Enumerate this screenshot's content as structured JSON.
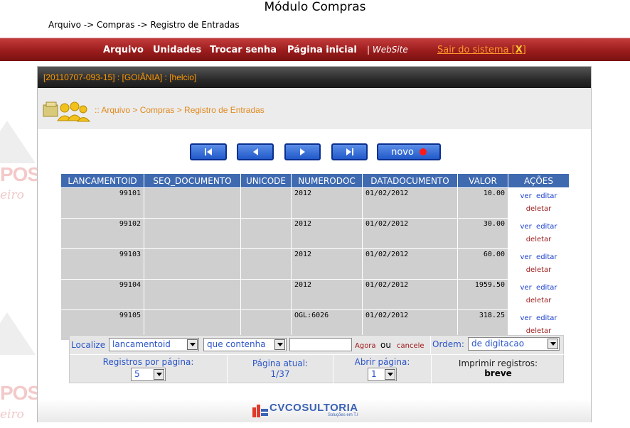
{
  "page": {
    "title": "Módulo Compras",
    "breadcrumb": "Arquivo -> Compras -> Registro de Entradas"
  },
  "navbar": {
    "items": [
      "Arquivo",
      "Unidades",
      "Trocar senha",
      "Página inicial"
    ],
    "website": "| WebSite",
    "logout_label": "Sair do sistema [",
    "logout_x": "X",
    "logout_close": "]"
  },
  "panel": {
    "header": "[20110707-093-15] : [GOIÂNIA] : [helcio]",
    "crumb": ":: Arquivo > Compras > Registro de Entradas"
  },
  "pager": {
    "novo_label": "novo"
  },
  "table": {
    "columns": [
      "LANCAMENTOID",
      "SEQ_DOCUMENTO",
      "UNICODE",
      "NUMERODOC",
      "DATADOCUMENTO",
      "VALOR",
      "AÇÕES"
    ],
    "rows": [
      {
        "lancamentoid": "99101",
        "seq_documento": "",
        "unicode": "",
        "numerodoc": "2012",
        "datadocumento": "01/02/2012",
        "valor": "10.00"
      },
      {
        "lancamentoid": "99102",
        "seq_documento": "",
        "unicode": "",
        "numerodoc": "2012",
        "datadocumento": "01/02/2012",
        "valor": "30.00"
      },
      {
        "lancamentoid": "99103",
        "seq_documento": "",
        "unicode": "",
        "numerodoc": "2012",
        "datadocumento": "01/02/2012",
        "valor": "60.00"
      },
      {
        "lancamentoid": "99104",
        "seq_documento": "",
        "unicode": "",
        "numerodoc": "2012",
        "datadocumento": "01/02/2012",
        "valor": "1959.50"
      },
      {
        "lancamentoid": "99105",
        "seq_documento": "",
        "unicode": "",
        "numerodoc": "OGL:6026",
        "datadocumento": "01/02/2012",
        "valor": "318.25"
      }
    ],
    "actions": {
      "ver": "ver",
      "editar": "editar",
      "deletar": "deletar"
    }
  },
  "search": {
    "localize_label": "Localize",
    "field_value": "lancamentoid",
    "condition_value": "que contenha",
    "text_value": "",
    "agora": "Agora",
    "ou": "ou",
    "cancele": "cancele",
    "ordem_label": "Ordem:",
    "ordem_value": "de digitacao",
    "registros_label": "Registros por página:",
    "registros_value": "5",
    "pagina_atual_label": "Página atual:",
    "pagina_atual_value": "1/37",
    "abrir_label": "Abrir página:",
    "abrir_value": "1",
    "imprimir_label": "Imprimir registros:",
    "imprimir_value": "breve"
  },
  "footer": {
    "logo_name": "CVCOSULTORIA",
    "logo_sub": "Soluções em T.I"
  },
  "watermark": {
    "pos": "POS",
    "eiro": "eiro"
  },
  "colors": {
    "navbar": "#9b1c1c",
    "header_text": "#ff9900",
    "table_header": "#3f6ab0",
    "button_blue": "#2159c9"
  }
}
